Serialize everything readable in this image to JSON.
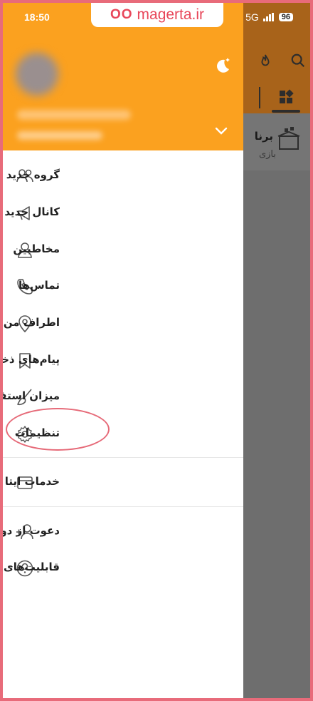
{
  "status_bar": {
    "time": "18:50",
    "network": "5G",
    "battery": "96"
  },
  "watermark": {
    "logo": "OO",
    "text": "magerta.ir"
  },
  "background_app": {
    "chat_title": "برنا",
    "chat_subtitle": "بازی"
  },
  "drawer": {
    "menu": [
      {
        "label": "گروه جدید",
        "icon": "group-icon"
      },
      {
        "label": "کانال جدید",
        "icon": "megaphone-icon"
      },
      {
        "label": "مخاطبین",
        "icon": "person-icon"
      },
      {
        "label": "تماس‌ها",
        "icon": "phone-icon"
      },
      {
        "label": "اطراف من",
        "icon": "location-pin-icon"
      },
      {
        "label": "پیام‌های ذخیره شده",
        "icon": "bookmark-icon"
      },
      {
        "label": "میزان استفاده از حافظه",
        "icon": "broom-icon"
      },
      {
        "label": "تنظیمات",
        "icon": "gear-icon"
      }
    ],
    "services": {
      "label": "خدمات ایتا",
      "icon": "card-icon"
    },
    "extras": [
      {
        "label": "دعوت از دوستان",
        "icon": "add-person-icon"
      },
      {
        "label": "قابلیت‌های ایتا",
        "icon": "help-circle-icon"
      }
    ]
  },
  "colors": {
    "header": "#fba11f",
    "highlight": "#e66a78",
    "watermark": "#e8475a"
  }
}
